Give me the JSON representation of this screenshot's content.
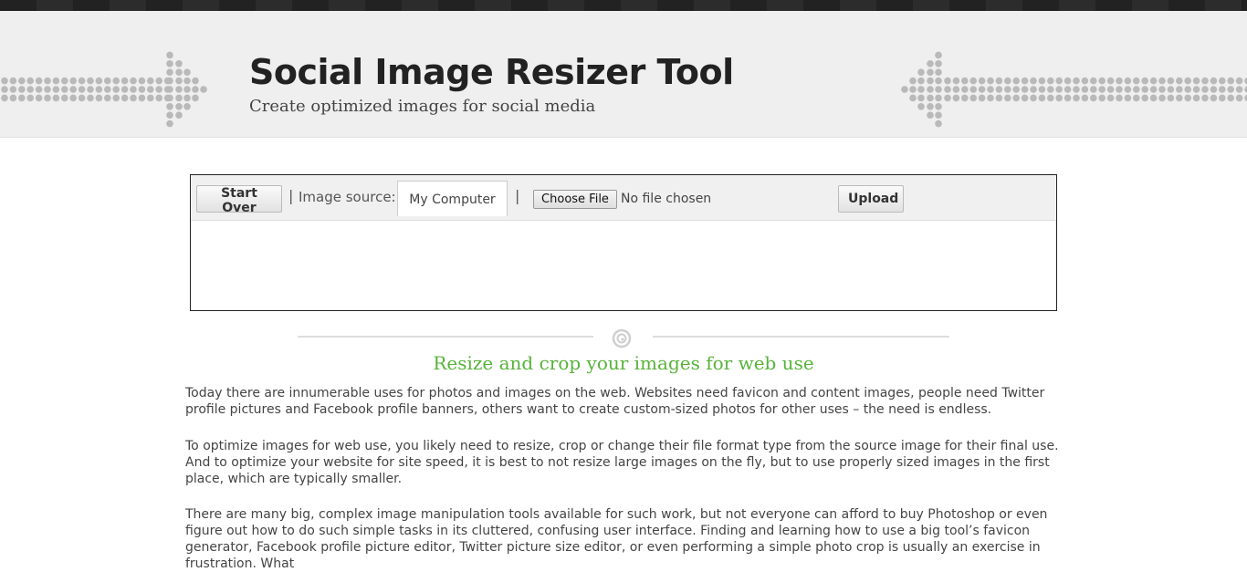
{
  "header": {
    "title": "Social Image Resizer Tool",
    "tagline": "Create optimized images for social media"
  },
  "tool": {
    "start_over": "Start Over",
    "separator": "|",
    "image_source_label": "Image source:",
    "source_tab": "My Computer",
    "choose_file": "Choose File",
    "file_status": "No file chosen",
    "upload": "Upload"
  },
  "content": {
    "section_title": "Resize and crop your images for web use",
    "paragraphs": [
      "Today there are innumerable uses for photos and images on the web. Websites need favicon and content images, people need Twitter profile pictures and Facebook profile banners, others want to create custom-sized photos for other uses – the need is endless.",
      "To optimize images for web use, you likely need to resize, crop or change their file format type from the source image for their final use. And to optimize your website for site speed, it is best to not resize large images on the fly, but to use properly sized images in the first place, which are typically smaller.",
      "There are many big, complex image manipulation tools available for such work, but not everyone can afford to buy Photoshop or even figure out how to do such simple tasks in its cluttered, confusing user interface. Finding and learning how to use a big tool’s favicon generator, Facebook profile picture editor, Twitter picture size editor, or even performing a simple photo crop is usually an exercise in frustration. What"
    ]
  },
  "colors": {
    "accent_green": "#58b33a",
    "header_bg": "#efefef",
    "topbar": "#222222"
  }
}
